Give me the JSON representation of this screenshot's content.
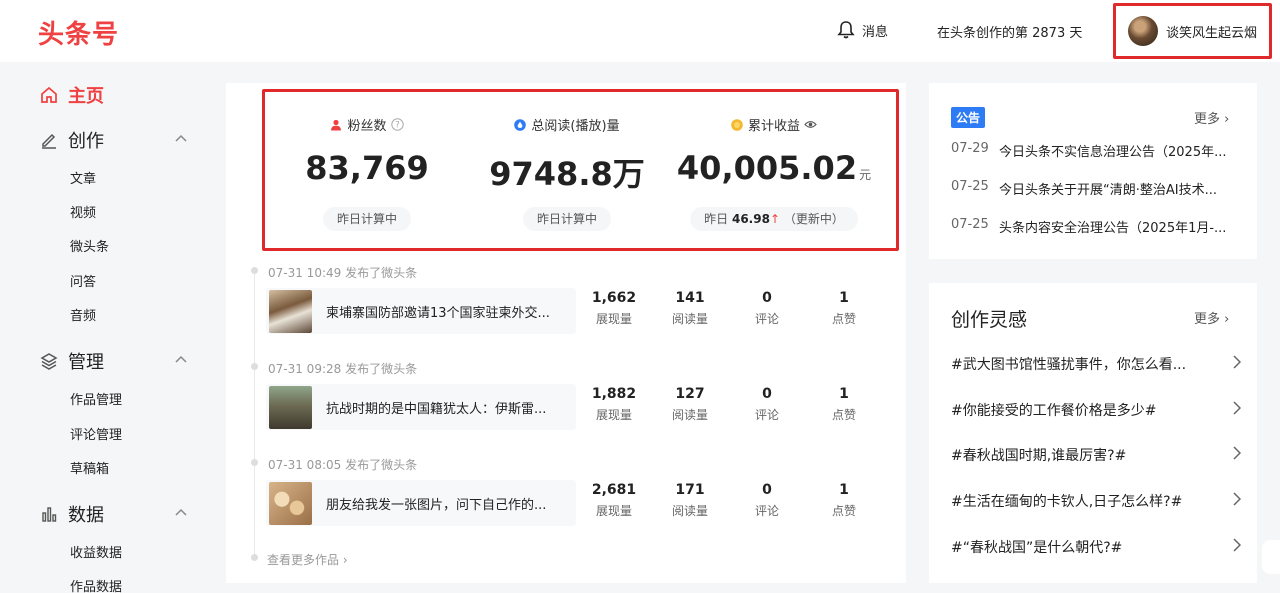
{
  "header": {
    "logo": "头条号",
    "messages_label": "消息",
    "days_label": "在头条创作的第 2873 天",
    "username": "谈笑风生起云烟"
  },
  "sidebar": {
    "home": "主页",
    "create": {
      "label": "创作",
      "items": [
        "文章",
        "视频",
        "微头条",
        "问答",
        "音频"
      ]
    },
    "manage": {
      "label": "管理",
      "items": [
        "作品管理",
        "评论管理",
        "草稿箱"
      ]
    },
    "data": {
      "label": "数据",
      "items": [
        "收益数据",
        "作品数据"
      ]
    }
  },
  "stats": {
    "fans": {
      "label": "粉丝数",
      "value": "83,769",
      "sub": "昨日计算中"
    },
    "reads": {
      "label": "总阅读(播放)量",
      "value": "9748.8万",
      "sub": "昨日计算中"
    },
    "income": {
      "label": "累计收益",
      "value": "40,005.02",
      "unit": "元",
      "sub_prefix": "昨日",
      "sub_value": "46.98",
      "sub_suffix": "（更新中）"
    }
  },
  "metric_labels": {
    "impressions": "展现量",
    "reads": "阅读量",
    "comments": "评论",
    "likes": "点赞"
  },
  "posts": [
    {
      "time": "07-31 10:49  发布了微头条",
      "title": "柬埔寨国防部邀请13个国家驻柬外交...",
      "impressions": "1,662",
      "reads": "141",
      "comments": "0",
      "likes": "1"
    },
    {
      "time": "07-31 09:28  发布了微头条",
      "title": "抗战时期的是中国籍犹太人：伊斯雷...",
      "impressions": "1,882",
      "reads": "127",
      "comments": "0",
      "likes": "1"
    },
    {
      "time": "07-31 08:05  发布了微头条",
      "title": "朋友给我发一张图片，问下自己作的...",
      "impressions": "2,681",
      "reads": "171",
      "comments": "0",
      "likes": "1"
    }
  ],
  "more_works": "查看更多作品",
  "notice": {
    "badge": "公告",
    "more": "更多",
    "items": [
      {
        "date": "07-29",
        "text": "今日头条不实信息治理公告（2025年..."
      },
      {
        "date": "07-25",
        "text": "今日头条关于开展“清朗·整治AI技术..."
      },
      {
        "date": "07-25",
        "text": "头条内容安全治理公告（2025年1月-..."
      }
    ]
  },
  "inspiration": {
    "title": "创作灵感",
    "more": "更多",
    "topics": [
      "#武大图书馆性骚扰事件，你怎么看...",
      "#你能接受的工作餐价格是多少#",
      "#春秋战国时期,谁最厉害?#",
      "#生活在缅甸的卡钦人,日子怎么样?#",
      "#“春秋战国”是什么朝代?#"
    ]
  },
  "colors": {
    "brand": "#f04142",
    "highlight_border": "#e0292b",
    "notice_badge": "#2d7cf6"
  }
}
